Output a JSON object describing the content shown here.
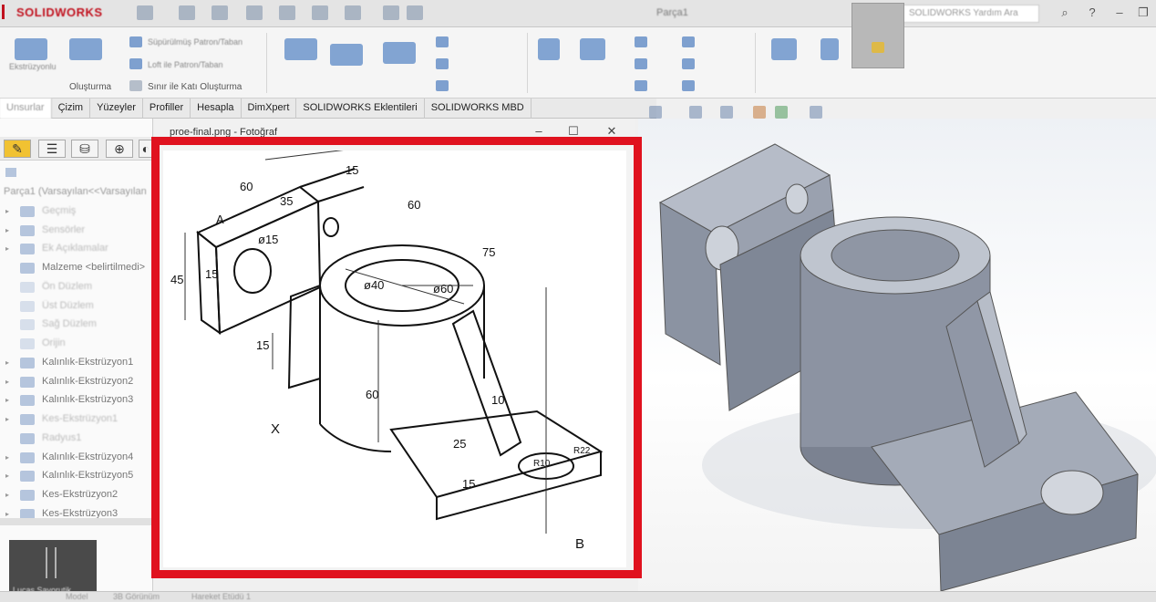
{
  "app": {
    "brand": "SOLIDWORKS",
    "document_title": "Parça1",
    "search_placeholder": "SOLIDWORKS Yardım Ara"
  },
  "ribbon": {
    "group1_label": "Oluşturma",
    "sweep_label": "Süpürülmüş Patron/Taban",
    "loft_label": "Loft ile Patron/Taban",
    "boundary_label": "Sınır ile Katı Oluşturma"
  },
  "tabs": [
    {
      "label": "Unsurlar",
      "active": true
    },
    {
      "label": "Çizim"
    },
    {
      "label": "Yüzeyler"
    },
    {
      "label": "Profiller"
    },
    {
      "label": "Hesapla"
    },
    {
      "label": "DimXpert"
    },
    {
      "label": "SOLIDWORKS Eklentileri"
    },
    {
      "label": "SOLIDWORKS MBD"
    }
  ],
  "feature_manager": {
    "root": "Parça1 (Varsayılan<<Varsayılan",
    "items": [
      {
        "label": "Geçmiş"
      },
      {
        "label": "Sensörler"
      },
      {
        "label": "Ek Açıklamalar"
      },
      {
        "label": "Malzeme <belirtilmedi>"
      },
      {
        "label": "Ön Düzlem"
      },
      {
        "label": "Üst Düzlem"
      },
      {
        "label": "Sağ Düzlem"
      },
      {
        "label": "Orijin"
      },
      {
        "label": "Kalınlık-Ekstrüzyon1"
      },
      {
        "label": "Kalınlık-Ekstrüzyon2"
      },
      {
        "label": "Kalınlık-Ekstrüzyon3"
      },
      {
        "label": "Kes-Ekstrüzyon1"
      },
      {
        "label": "Radyus1"
      },
      {
        "label": "Kalınlık-Ekstrüzyon4"
      },
      {
        "label": "Kalınlık-Ekstrüzyon5"
      },
      {
        "label": "Kes-Ekstrüzyon2"
      },
      {
        "label": "Kes-Ekstrüzyon3"
      }
    ]
  },
  "bottom_tabs": [
    "Model",
    "3B Görünüm",
    "Hareket Etüdü 1"
  ],
  "thumbnail_label": "Lucas Sayorutik",
  "photo_viewer": {
    "title": "proe-final.png - Fotoğraf"
  },
  "drawing": {
    "dims": [
      "60",
      "15",
      "35",
      "60",
      "75",
      "A",
      "45",
      "15",
      "ø15",
      "ø40",
      "ø60",
      "15",
      "60",
      "10",
      "25",
      "15",
      "R10",
      "R22",
      "X",
      "B"
    ]
  },
  "colors": {
    "frame_red": "#e0121f",
    "model_gray": "#8e95a3"
  }
}
